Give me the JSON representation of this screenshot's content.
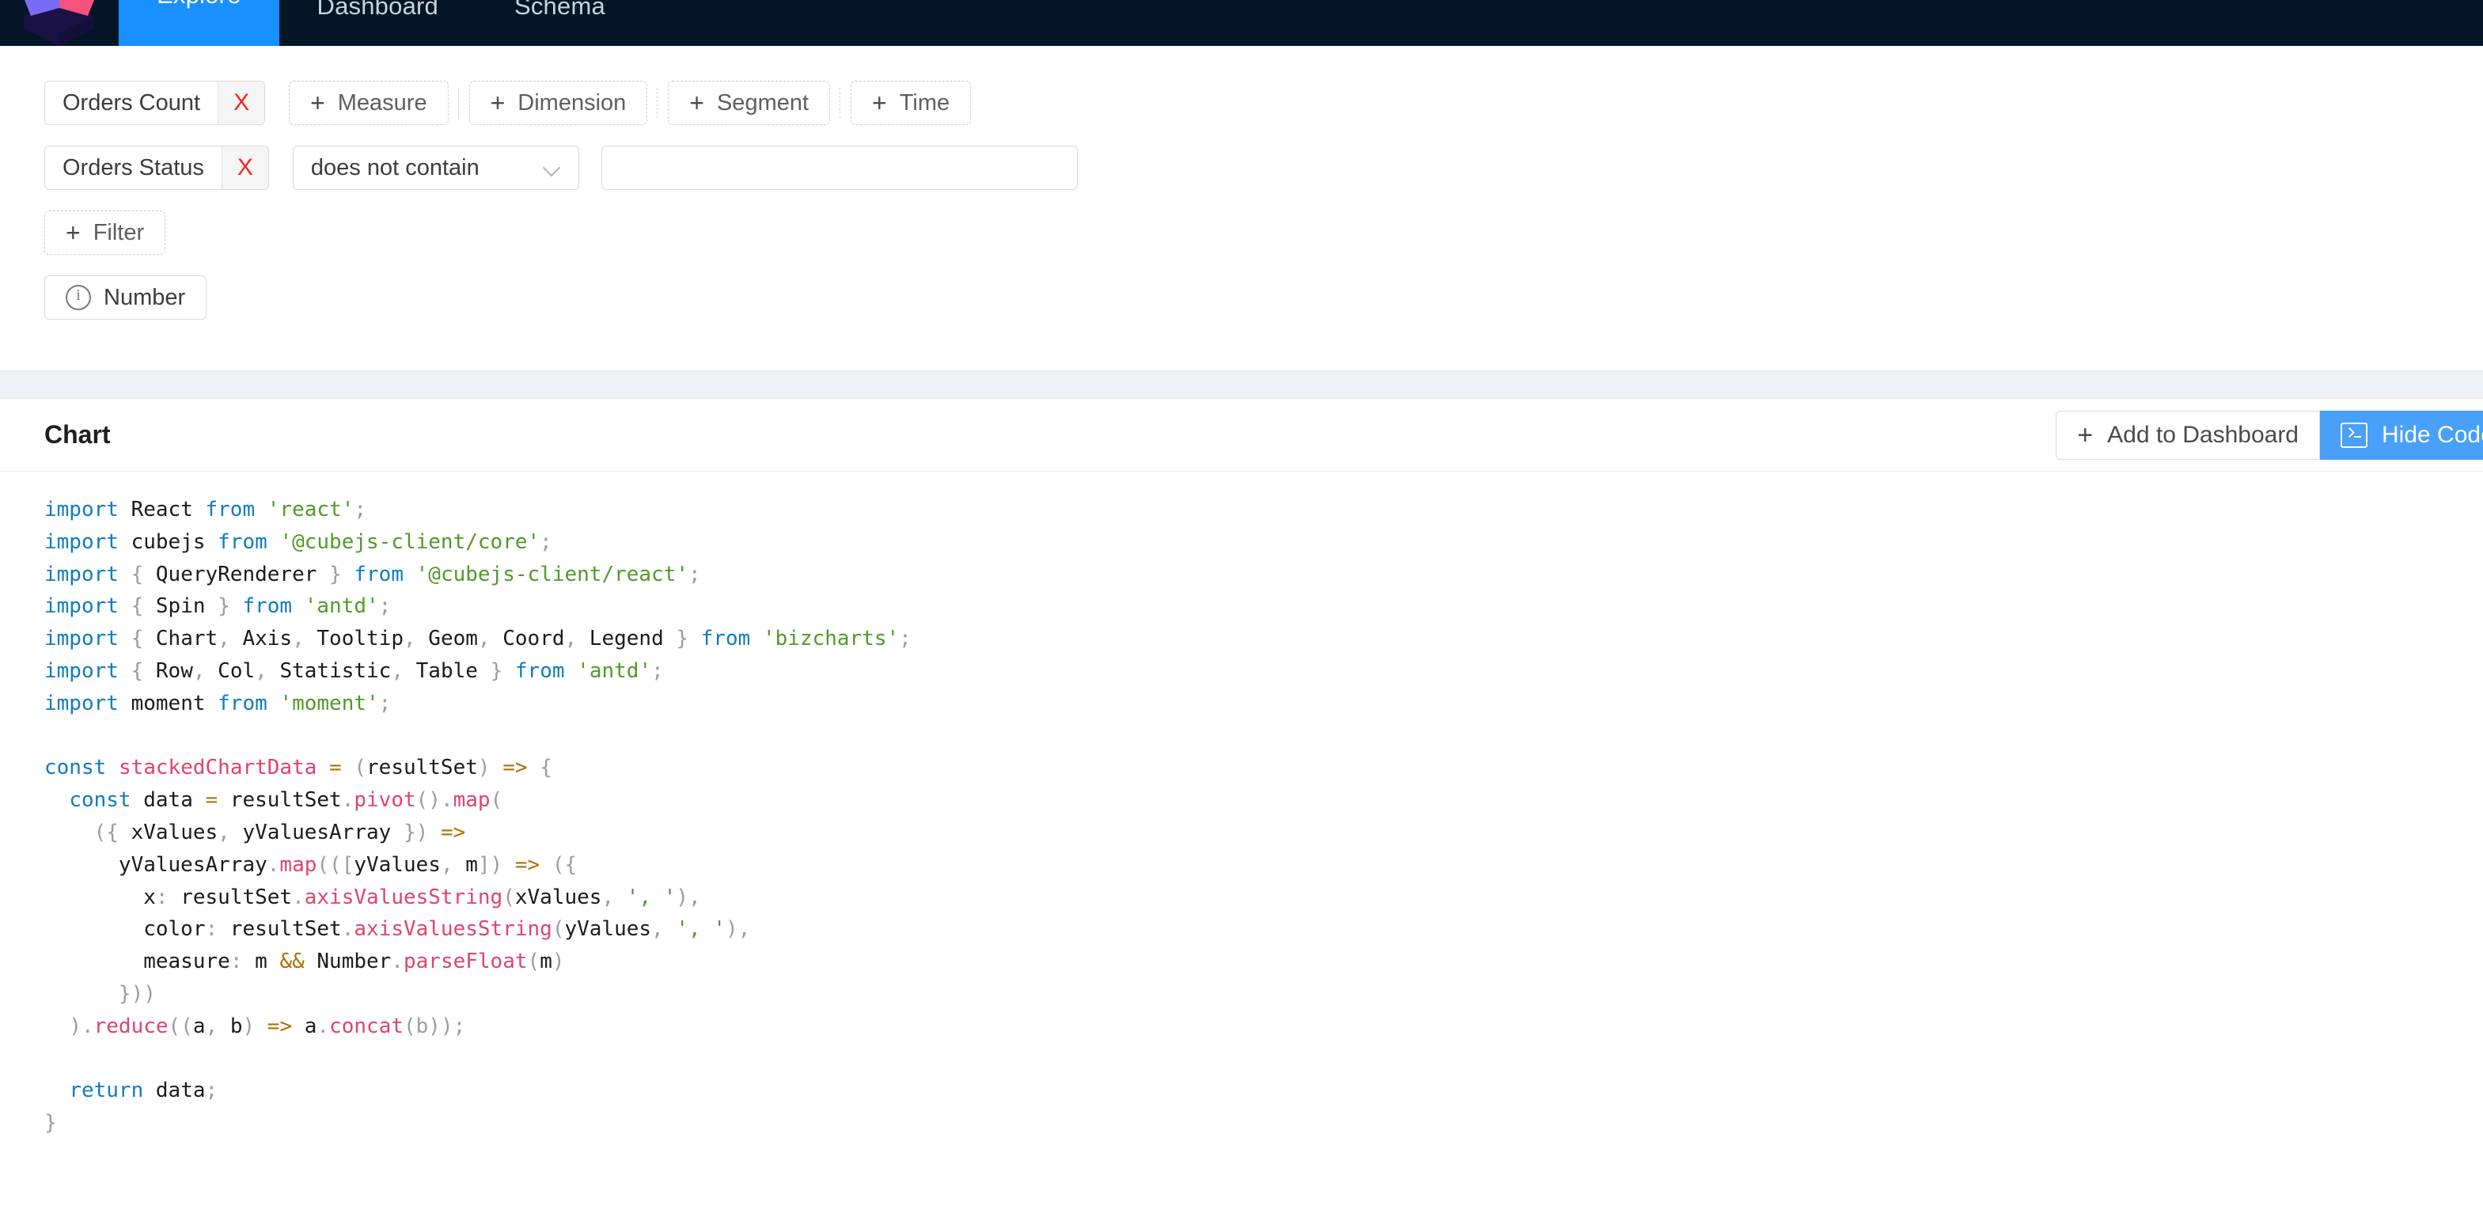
{
  "nav": {
    "logo_name": "cubejs-logo",
    "tabs": [
      {
        "label": "Explore",
        "active": true
      },
      {
        "label": "Dashboard",
        "active": false
      },
      {
        "label": "Schema",
        "active": false
      }
    ]
  },
  "query_builder": {
    "members_row": {
      "selected_measure": {
        "label": "Orders Count",
        "remove_label": "X"
      },
      "add_buttons": [
        {
          "label": "Measure",
          "plus": "+"
        },
        {
          "label": "Dimension",
          "plus": "+"
        },
        {
          "label": "Segment",
          "plus": "+"
        },
        {
          "label": "Time",
          "plus": "+"
        }
      ]
    },
    "filter_row": {
      "member": {
        "label": "Orders Status",
        "remove_label": "X"
      },
      "operator": {
        "value": "does not contain"
      },
      "value_input": {
        "value": "",
        "placeholder": ""
      }
    },
    "add_filter_button": {
      "label": "Filter",
      "plus": "+"
    },
    "chart_type_button": {
      "label": "Number",
      "icon": "info-circle-icon"
    }
  },
  "chart_panel": {
    "title": "Chart",
    "add_to_dashboard_button": {
      "label": "Add to Dashboard",
      "plus": "+"
    },
    "hide_code_button": {
      "label": "Hide Code",
      "icon": "terminal-icon"
    }
  },
  "code": {
    "language": "javascript",
    "colors": {
      "keyword": "#0f7cc0",
      "string": "#4f9b28",
      "function": "#e0436e",
      "punctuation": "#9c9c9c",
      "operator": "#b07000",
      "plain": "#1b1b1b"
    },
    "lines": [
      [
        [
          "kw",
          "import"
        ],
        [
          "plain",
          " React "
        ],
        [
          "kw",
          "from"
        ],
        [
          "plain",
          " "
        ],
        [
          "str",
          "'react'"
        ],
        [
          "punc",
          ";"
        ]
      ],
      [
        [
          "kw",
          "import"
        ],
        [
          "plain",
          " cubejs "
        ],
        [
          "kw",
          "from"
        ],
        [
          "plain",
          " "
        ],
        [
          "str",
          "'@cubejs-client/core'"
        ],
        [
          "punc",
          ";"
        ]
      ],
      [
        [
          "kw",
          "import"
        ],
        [
          "plain",
          " "
        ],
        [
          "punc",
          "{"
        ],
        [
          "plain",
          " QueryRenderer "
        ],
        [
          "punc",
          "}"
        ],
        [
          "plain",
          " "
        ],
        [
          "kw",
          "from"
        ],
        [
          "plain",
          " "
        ],
        [
          "str",
          "'@cubejs-client/react'"
        ],
        [
          "punc",
          ";"
        ]
      ],
      [
        [
          "kw",
          "import"
        ],
        [
          "plain",
          " "
        ],
        [
          "punc",
          "{"
        ],
        [
          "plain",
          " Spin "
        ],
        [
          "punc",
          "}"
        ],
        [
          "plain",
          " "
        ],
        [
          "kw",
          "from"
        ],
        [
          "plain",
          " "
        ],
        [
          "str",
          "'antd'"
        ],
        [
          "punc",
          ";"
        ]
      ],
      [
        [
          "kw",
          "import"
        ],
        [
          "plain",
          " "
        ],
        [
          "punc",
          "{"
        ],
        [
          "plain",
          " Chart"
        ],
        [
          "punc",
          ","
        ],
        [
          "plain",
          " Axis"
        ],
        [
          "punc",
          ","
        ],
        [
          "plain",
          " Tooltip"
        ],
        [
          "punc",
          ","
        ],
        [
          "plain",
          " Geom"
        ],
        [
          "punc",
          ","
        ],
        [
          "plain",
          " Coord"
        ],
        [
          "punc",
          ","
        ],
        [
          "plain",
          " Legend "
        ],
        [
          "punc",
          "}"
        ],
        [
          "plain",
          " "
        ],
        [
          "kw",
          "from"
        ],
        [
          "plain",
          " "
        ],
        [
          "str",
          "'bizcharts'"
        ],
        [
          "punc",
          ";"
        ]
      ],
      [
        [
          "kw",
          "import"
        ],
        [
          "plain",
          " "
        ],
        [
          "punc",
          "{"
        ],
        [
          "plain",
          " Row"
        ],
        [
          "punc",
          ","
        ],
        [
          "plain",
          " Col"
        ],
        [
          "punc",
          ","
        ],
        [
          "plain",
          " Statistic"
        ],
        [
          "punc",
          ","
        ],
        [
          "plain",
          " Table "
        ],
        [
          "punc",
          "}"
        ],
        [
          "plain",
          " "
        ],
        [
          "kw",
          "from"
        ],
        [
          "plain",
          " "
        ],
        [
          "str",
          "'antd'"
        ],
        [
          "punc",
          ";"
        ]
      ],
      [
        [
          "kw",
          "import"
        ],
        [
          "plain",
          " moment "
        ],
        [
          "kw",
          "from"
        ],
        [
          "plain",
          " "
        ],
        [
          "str",
          "'moment'"
        ],
        [
          "punc",
          ";"
        ]
      ],
      [],
      [
        [
          "kw",
          "const"
        ],
        [
          "plain",
          " "
        ],
        [
          "fn",
          "stackedChartData"
        ],
        [
          "plain",
          " "
        ],
        [
          "op",
          "="
        ],
        [
          "plain",
          " "
        ],
        [
          "punc",
          "("
        ],
        [
          "plain",
          "resultSet"
        ],
        [
          "punc",
          ")"
        ],
        [
          "plain",
          " "
        ],
        [
          "op",
          "=>"
        ],
        [
          "plain",
          " "
        ],
        [
          "punc",
          "{"
        ]
      ],
      [
        [
          "plain",
          "  "
        ],
        [
          "kw",
          "const"
        ],
        [
          "plain",
          " data "
        ],
        [
          "op",
          "="
        ],
        [
          "plain",
          " resultSet"
        ],
        [
          "punc",
          "."
        ],
        [
          "fn",
          "pivot"
        ],
        [
          "punc",
          "()."
        ],
        [
          "fn",
          "map"
        ],
        [
          "punc",
          "("
        ]
      ],
      [
        [
          "plain",
          "    "
        ],
        [
          "punc",
          "({"
        ],
        [
          "plain",
          " xValues"
        ],
        [
          "punc",
          ","
        ],
        [
          "plain",
          " yValuesArray "
        ],
        [
          "punc",
          "})"
        ],
        [
          "plain",
          " "
        ],
        [
          "op",
          "=>"
        ]
      ],
      [
        [
          "plain",
          "      yValuesArray"
        ],
        [
          "punc",
          "."
        ],
        [
          "fn",
          "map"
        ],
        [
          "punc",
          "((["
        ],
        [
          "plain",
          "yValues"
        ],
        [
          "punc",
          ","
        ],
        [
          "plain",
          " m"
        ],
        [
          "punc",
          "])"
        ],
        [
          "plain",
          " "
        ],
        [
          "op",
          "=>"
        ],
        [
          "plain",
          " "
        ],
        [
          "punc",
          "({"
        ]
      ],
      [
        [
          "plain",
          "        x"
        ],
        [
          "punc",
          ":"
        ],
        [
          "plain",
          " resultSet"
        ],
        [
          "punc",
          "."
        ],
        [
          "fn",
          "axisValuesString"
        ],
        [
          "punc",
          "("
        ],
        [
          "plain",
          "xValues"
        ],
        [
          "punc",
          ","
        ],
        [
          "plain",
          " "
        ],
        [
          "str",
          "', '"
        ],
        [
          "punc",
          "),"
        ]
      ],
      [
        [
          "plain",
          "        color"
        ],
        [
          "punc",
          ":"
        ],
        [
          "plain",
          " resultSet"
        ],
        [
          "punc",
          "."
        ],
        [
          "fn",
          "axisValuesString"
        ],
        [
          "punc",
          "("
        ],
        [
          "plain",
          "yValues"
        ],
        [
          "punc",
          ","
        ],
        [
          "plain",
          " "
        ],
        [
          "str",
          "', '"
        ],
        [
          "punc",
          "),"
        ]
      ],
      [
        [
          "plain",
          "        measure"
        ],
        [
          "punc",
          ":"
        ],
        [
          "plain",
          " m "
        ],
        [
          "op",
          "&&"
        ],
        [
          "plain",
          " Number"
        ],
        [
          "punc",
          "."
        ],
        [
          "fn",
          "parseFloat"
        ],
        [
          "punc",
          "("
        ],
        [
          "plain",
          "m"
        ],
        [
          "punc",
          ")"
        ]
      ],
      [
        [
          "plain",
          "      "
        ],
        [
          "punc",
          "}))"
        ]
      ],
      [
        [
          "plain",
          "  "
        ],
        [
          "punc",
          ")."
        ],
        [
          "fn",
          "reduce"
        ],
        [
          "punc",
          "(("
        ],
        [
          "plain",
          "a"
        ],
        [
          "punc",
          ","
        ],
        [
          "plain",
          " b"
        ],
        [
          "punc",
          ")"
        ],
        [
          "plain",
          " "
        ],
        [
          "op",
          "=>"
        ],
        [
          "plain",
          " a"
        ],
        [
          "punc",
          "."
        ],
        [
          "fn",
          "concat"
        ],
        [
          "punc",
          "(b));"
        ]
      ],
      [],
      [
        [
          "plain",
          "  "
        ],
        [
          "kw",
          "return"
        ],
        [
          "plain",
          " data"
        ],
        [
          "punc",
          ";"
        ]
      ],
      [
        [
          "punc",
          "}"
        ]
      ]
    ]
  }
}
